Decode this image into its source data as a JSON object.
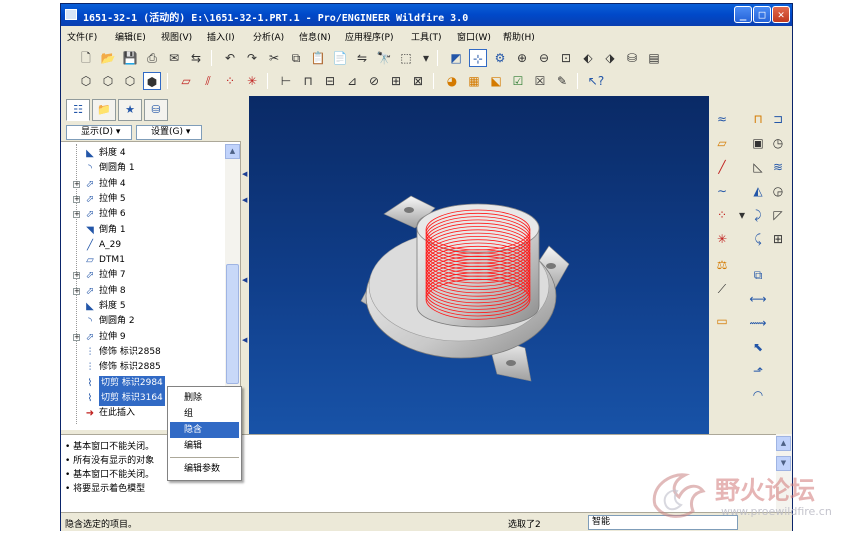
{
  "window": {
    "title": "1651-32-1 (活动的) E:\\1651-32-1.PRT.1 - Pro/ENGINEER Wildfire 3.0",
    "minimize": "_",
    "maximize": "□",
    "close": "✕"
  },
  "menu": [
    "文件(F)",
    "编辑(E)",
    "视图(V)",
    "插入(I)",
    "分析(A)",
    "信息(N)",
    "应用程序(P)",
    "工具(T)",
    "窗口(W)",
    "帮助(H)"
  ],
  "left_panel": {
    "show_dropdown": "显示(D) ▾",
    "settings_dropdown": "设置(G) ▾"
  },
  "model_tree": [
    {
      "label": "斜度 4",
      "icon": "draft-icon",
      "glyph": "◣",
      "expandable": false
    },
    {
      "label": "倒圆角 1",
      "icon": "round-icon",
      "glyph": "◝",
      "expandable": false
    },
    {
      "label": "拉伸 4",
      "icon": "extrude-icon",
      "glyph": "⬀",
      "expandable": true
    },
    {
      "label": "拉伸 5",
      "icon": "extrude-icon",
      "glyph": "⬀",
      "expandable": true
    },
    {
      "label": "拉伸 6",
      "icon": "extrude-icon",
      "glyph": "⬀",
      "expandable": true
    },
    {
      "label": "倒角 1",
      "icon": "chamfer-icon",
      "glyph": "◥",
      "expandable": false
    },
    {
      "label": "A_29",
      "icon": "axis-icon",
      "glyph": "╱",
      "expandable": false
    },
    {
      "label": "DTM1",
      "icon": "datum-plane-icon",
      "glyph": "▱",
      "expandable": false
    },
    {
      "label": "拉伸 7",
      "icon": "extrude-icon",
      "glyph": "⬀",
      "expandable": true
    },
    {
      "label": "拉伸 8",
      "icon": "extrude-icon",
      "glyph": "⬀",
      "expandable": true
    },
    {
      "label": "斜度 5",
      "icon": "draft-icon",
      "glyph": "◣",
      "expandable": false
    },
    {
      "label": "倒圆角 2",
      "icon": "round-icon",
      "glyph": "◝",
      "expandable": false
    },
    {
      "label": "拉伸 9",
      "icon": "extrude-icon",
      "glyph": "⬀",
      "expandable": true
    },
    {
      "label": "修饰 标识2858",
      "icon": "cosmetic-thread-icon",
      "glyph": "⫶",
      "expandable": false
    },
    {
      "label": "修饰 标识2885",
      "icon": "cosmetic-thread-icon",
      "glyph": "⫶",
      "expandable": false
    },
    {
      "label": "切剪 标识2984",
      "icon": "cut-icon",
      "glyph": "⌇",
      "expandable": false,
      "selected": true
    },
    {
      "label": "切剪 标识3164",
      "icon": "cut-icon",
      "glyph": "⌇",
      "expandable": false,
      "selected": true
    },
    {
      "label": "在此插入",
      "icon": "insert-here-icon",
      "glyph": "➜",
      "expandable": false
    }
  ],
  "context_menu": [
    "删除",
    "组",
    "隐含",
    "编辑",
    "编辑参数"
  ],
  "context_menu_highlighted": "隐含",
  "messages": [
    "• 基本窗口不能关闭。",
    "• 所有没有显示的对象",
    "• 基本窗口不能关闭。",
    "• 将要显示着色模型"
  ],
  "status": {
    "hint": "隐含选定的项目。",
    "selected": "选取了2",
    "filter": "智能"
  },
  "watermark": {
    "text": "野火论坛",
    "url": "www.proewildfire.cn"
  }
}
